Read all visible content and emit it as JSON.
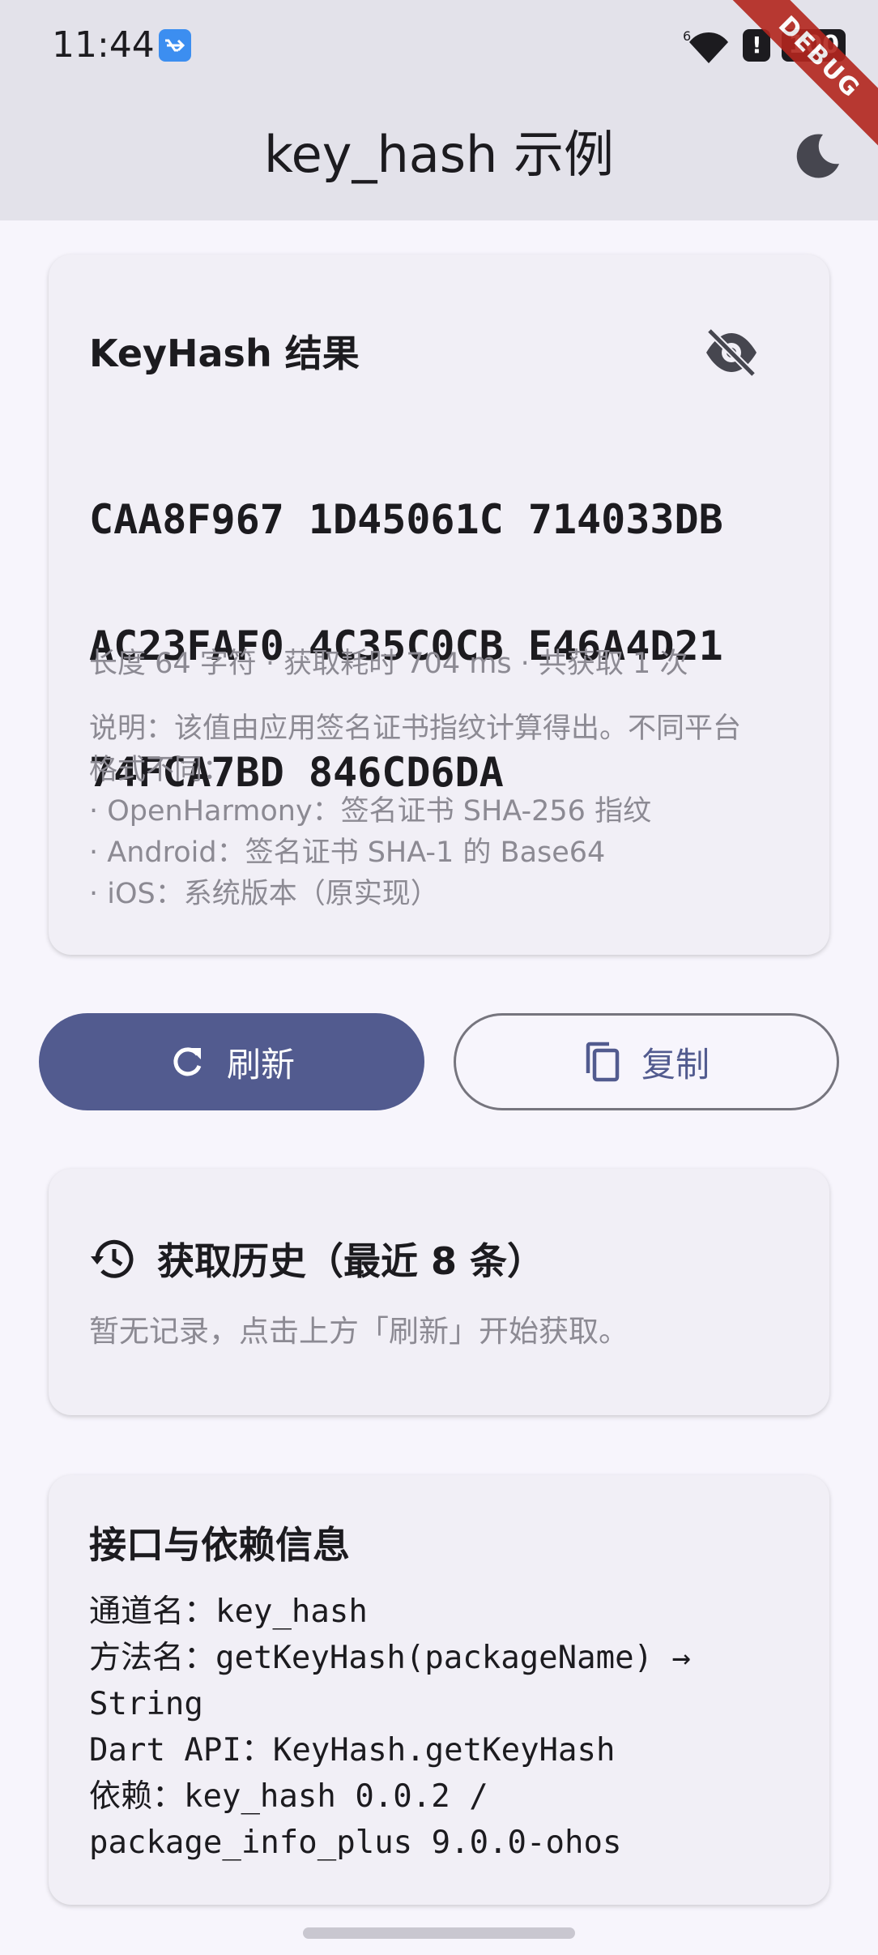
{
  "status_bar": {
    "time": "11:44",
    "signal_label": "6",
    "alert_label": "!",
    "battery": "100",
    "debug_banner": "DEBUG"
  },
  "app_bar": {
    "title": "key_hash 示例",
    "theme_icon": "dark-mode-moon-icon"
  },
  "result_card": {
    "title": "KeyHash 结果",
    "visibility_icon": "visibility-off-icon",
    "hash_lines": [
      "CAA8F967 1D45061C 714033DB",
      "AC23FAF0 4C35C0CB E46A4D21",
      "74FCA7BD 846CD6DA"
    ],
    "meta": "长度 64 字符 · 获取耗时 704 ms · 共获取 1 次",
    "note_lines": [
      "说明：该值由应用签名证书指纹计算得出。不同平台",
      "格式不同：",
      "· OpenHarmony：签名证书 SHA-256 指纹",
      "· Android：签名证书 SHA-1 的 Base64",
      "· iOS：系统版本（原实现）"
    ]
  },
  "actions": {
    "refresh_label": "刷新",
    "copy_label": "复制"
  },
  "history_card": {
    "title": "获取历史（最近 8 条）",
    "empty_text": "暂无记录，点击上方「刷新」开始获取。"
  },
  "info_card": {
    "title": "接口与依赖信息",
    "lines": [
      "通道名：key_hash",
      "方法名：getKeyHash(packageName) →",
      "String",
      "Dart API：KeyHash.getKeyHash",
      "依赖：key_hash 0.0.2 /",
      "package_info_plus 9.0.0-ohos"
    ]
  },
  "colors": {
    "primary": "#525b8f",
    "app_bar": "#e3e2ea",
    "background": "#f7f5fc",
    "card": "#f1eff6",
    "muted_text": "#8c8a93"
  }
}
